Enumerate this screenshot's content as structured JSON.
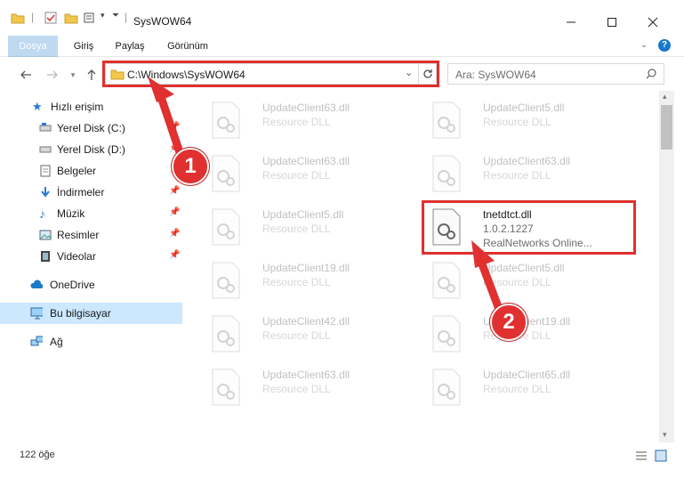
{
  "window": {
    "title": "SysWOW64",
    "minimize_icon": "minimize-icon",
    "maximize_icon": "maximize-icon",
    "close_icon": "close-icon"
  },
  "ribbon": {
    "tabs": [
      {
        "label": "Dosya"
      },
      {
        "label": "Giriş"
      },
      {
        "label": "Paylaş"
      },
      {
        "label": "Görünüm"
      }
    ]
  },
  "address": {
    "path": "C:\\Windows\\SysWOW64",
    "search_placeholder": "Ara: SysWOW64"
  },
  "nav": {
    "quick_access": "Hızlı erişim",
    "items": [
      {
        "label": "Yerel Disk (C:)",
        "pinned": true
      },
      {
        "label": "Yerel Disk (D:)",
        "pinned": true
      },
      {
        "label": "Belgeler",
        "pinned": true
      },
      {
        "label": "İndirmeler",
        "pinned": true
      },
      {
        "label": "Müzik",
        "pinned": true
      },
      {
        "label": "Resimler",
        "pinned": true
      },
      {
        "label": "Videolar",
        "pinned": true
      }
    ],
    "onedrive": "OneDrive",
    "this_pc": "Bu bilgisayar",
    "network": "Ağ"
  },
  "files": {
    "left": [
      {
        "name": "UpdateClient63.dll",
        "type": "Resource DLL"
      },
      {
        "name": "UpdateClient63.dll",
        "type": "Resource DLL"
      },
      {
        "name": "UpdateClient5.dll",
        "type": "Resource DLL"
      },
      {
        "name": "UpdateClient19.dll",
        "type": "Resource DLL"
      },
      {
        "name": "UpdateClient42.dll",
        "type": "Resource DLL"
      },
      {
        "name": "UpdateClient63.dll",
        "type": "Resource DLL"
      }
    ],
    "right": [
      {
        "name": "UpdateClient5.dll",
        "type": "Resource DLL"
      },
      {
        "name": "UpdateClient63.dll",
        "type": "Resource DLL"
      },
      {
        "name": "tnetdtct.dll",
        "version": "1.0.2.1227",
        "company": "RealNetworks Online..."
      },
      {
        "name": "UpdateClient5.dll",
        "type": "Resource DLL"
      },
      {
        "name": "UpdateClient19.dll",
        "type": "Resource DLL"
      },
      {
        "name": "UpdateClient65.dll",
        "type": "Resource DLL"
      }
    ]
  },
  "status": {
    "count": "122 öğe"
  },
  "annotations": {
    "step1": "1",
    "step2": "2",
    "color": "#e0302f"
  }
}
